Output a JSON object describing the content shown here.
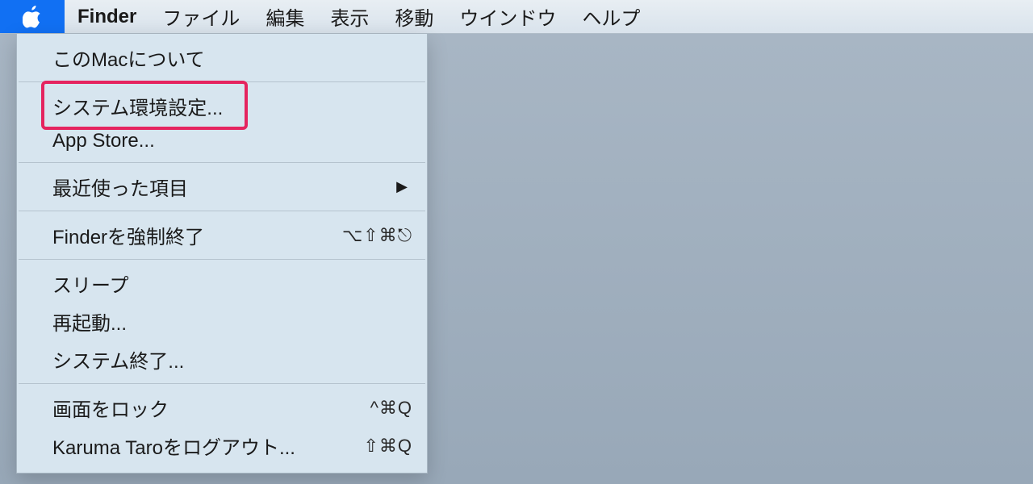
{
  "menubar": {
    "active_app": "Finder",
    "items": [
      "ファイル",
      "編集",
      "表示",
      "移動",
      "ウインドウ",
      "ヘルプ"
    ]
  },
  "apple_menu": {
    "about": "このMacについて",
    "system_prefs": "システム環境設定...",
    "app_store": "App Store...",
    "recent_items": "最近使った項目",
    "force_quit": {
      "label": "Finderを強制終了",
      "shortcut": "⌥⇧⌘⎋"
    },
    "sleep": "スリープ",
    "restart": "再起動...",
    "shutdown": "システム終了...",
    "lock_screen": {
      "label": "画面をロック",
      "shortcut": "^⌘Q"
    },
    "logout": {
      "label": "Karuma Taroをログアウト...",
      "shortcut": "⇧⌘Q"
    }
  },
  "annotation": {
    "target": "system_prefs"
  }
}
